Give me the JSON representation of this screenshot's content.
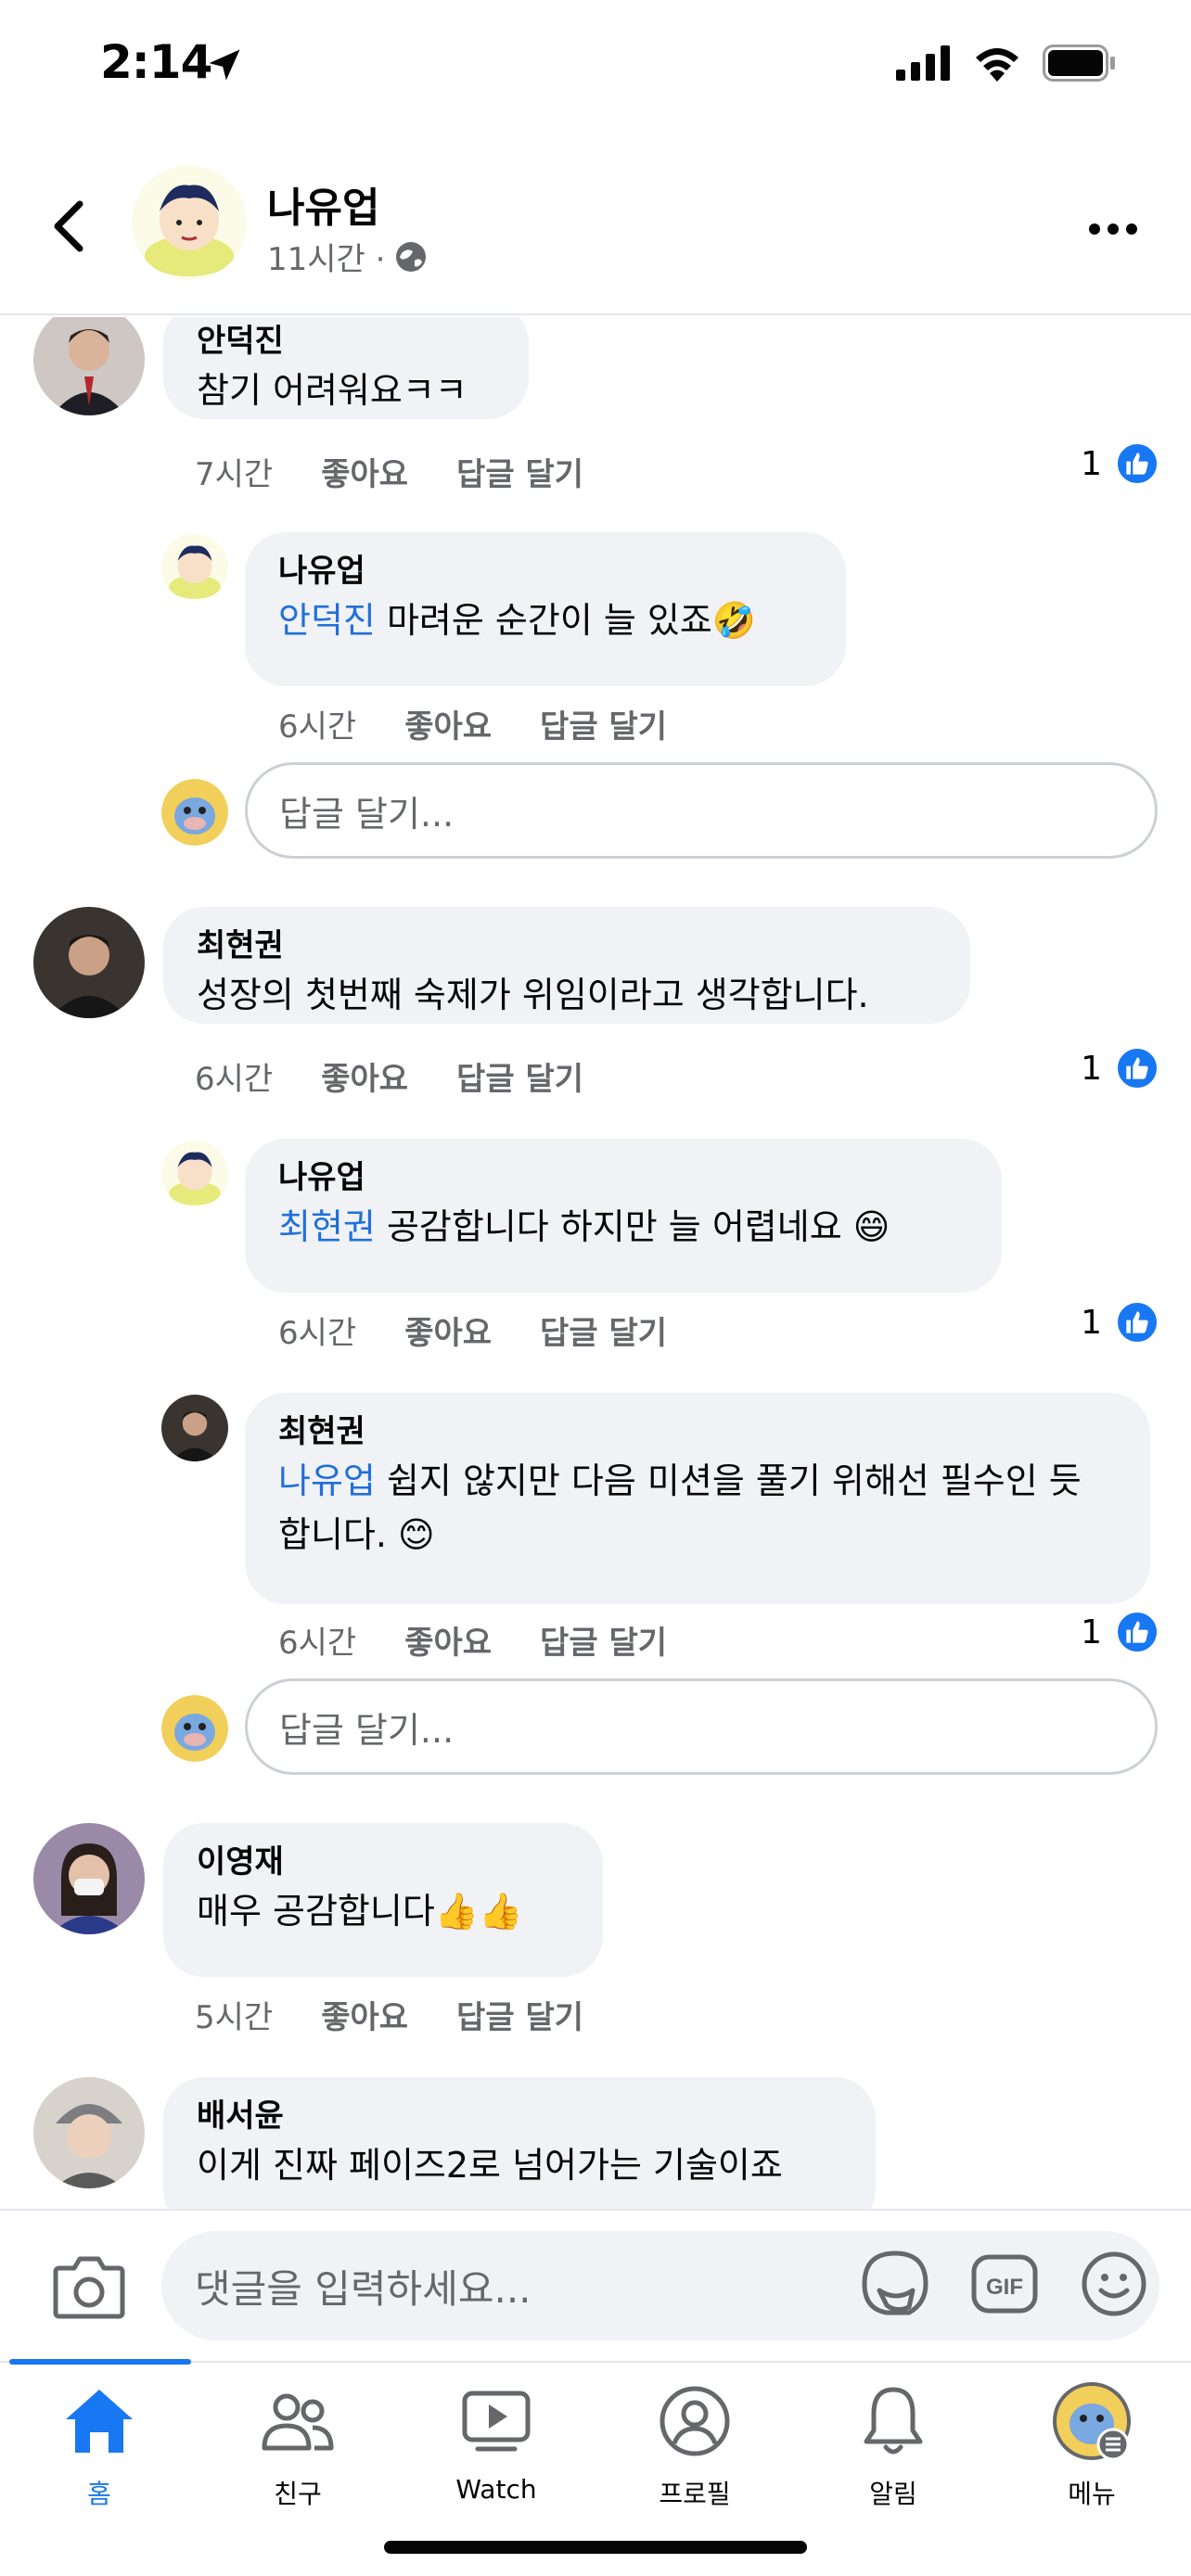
{
  "status": {
    "time": "2:14"
  },
  "header": {
    "name": "나유업",
    "meta": "11시간 ·"
  },
  "labels": {
    "like": "좋아요",
    "reply": "답글 달기"
  },
  "comments": [
    {
      "author": "안덕진",
      "text": "참기 어려워요ㅋㅋ",
      "time": "7시간",
      "likes": "1"
    },
    {
      "author": "나유업",
      "mention": "안덕진",
      "text": " 마려운 순간이 늘 있죠🤣",
      "time": "6시간"
    },
    {
      "author": "최현권",
      "text": "성장의 첫번째 숙제가 위임이라고 생각합니다.",
      "time": "6시간",
      "likes": "1"
    },
    {
      "author": "나유업",
      "mention": "최현권",
      "text": " 공감합니다 하지만 늘 어렵네요 😄",
      "time": "6시간",
      "likes": "1"
    },
    {
      "author": "최현권",
      "mention": "나유업",
      "text": " 쉽지 않지만 다음 미션을 풀기 위해선 필수인 듯 합니다. 😊",
      "time": "6시간",
      "likes": "1"
    },
    {
      "author": "이영재",
      "text": "매우 공감합니다👍👍",
      "time": "5시간"
    },
    {
      "author": "배서윤",
      "text": "이게 진짜 페이즈2로 넘어가는 기술이죠"
    }
  ],
  "reply_placeholder": "답글 달기...",
  "composer": {
    "placeholder": "댓글을 입력하세요..."
  },
  "tabs": [
    {
      "label": "홈",
      "icon": "home-icon"
    },
    {
      "label": "친구",
      "icon": "friends-icon"
    },
    {
      "label": "Watch",
      "icon": "watch-icon"
    },
    {
      "label": "프로필",
      "icon": "profile-icon"
    },
    {
      "label": "알림",
      "icon": "bell-icon"
    },
    {
      "label": "메뉴",
      "icon": "menu-icon"
    }
  ],
  "colors": {
    "accent": "#1877f2",
    "mention": "#216fdb",
    "bubble": "#f0f2f5"
  }
}
